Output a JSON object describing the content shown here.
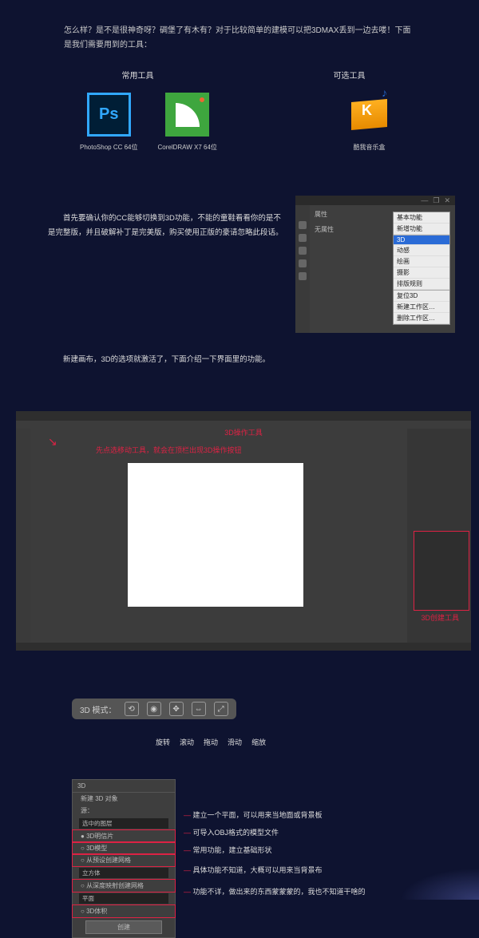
{
  "intro": "怎么样？是不是很神奇呀？碉堡了有木有？对于比较简单的建模可以把3DMAX丢到一边去喽！下面是我们需要用到的工具：",
  "section": {
    "left": "常用工具",
    "right": "可选工具"
  },
  "tools": {
    "ps_label": "PhotoShop CC 64位",
    "ps_badge": "Ps",
    "cd_label": "CorelDRAW X7 64位",
    "ku_label": "酷我音乐盒",
    "ku_k": "K"
  },
  "para1_a": "首先要确认你的CC能够切换到3D功能，不能的童鞋看看你的是不是完整版，并且破解补丁是完美版，购买使用正版的豪请忽略此段话。",
  "para2": "新建画布，3D的选项就激活了，下面介绍一下界面里的功能。",
  "panel": {
    "mid_tab": "属性",
    "mid_text": "无属性",
    "menu": {
      "i0": "基本功能",
      "i1": "新增功能",
      "i2": "3D",
      "i3": "动感",
      "i4": "绘画",
      "i5": "摄影",
      "i6": "排版规则",
      "i7": "复位3D",
      "i8": "新建工作区…",
      "i9": "删除工作区…"
    }
  },
  "ps_full": {
    "anno1": "3D操作工具",
    "anno2": "先点选移动工具，就会在顶栏出现3D操作按钮",
    "anno3": "3D创建工具"
  },
  "mode": {
    "label": "3D 模式：",
    "t0": "旋转",
    "t1": "滚动",
    "t2": "拖动",
    "t3": "滑动",
    "t4": "缩放"
  },
  "create_panel": {
    "tab": "3D",
    "title": "新建 3D 对象",
    "src_label": "源：",
    "src_val": "选中的图层",
    "r0": "3D明信片",
    "r1": "3D模型",
    "r2": "从预设创建网格",
    "r2_sel": "立方体",
    "r3": "从深度映射创建网格",
    "r3_sel": "平面",
    "r4": "3D体积",
    "btn": "创建"
  },
  "desc": {
    "d0": "建立一个平面，可以用来当地面或背景板",
    "d1": "可导入OBJ格式的模型文件",
    "d2": "常用功能，建立基础形状",
    "d3": "具体功能不知道，大概可以用来当背景布",
    "d4": "功能不详，做出来的东西蒙蒙蒙的，我也不知道干啥的"
  }
}
